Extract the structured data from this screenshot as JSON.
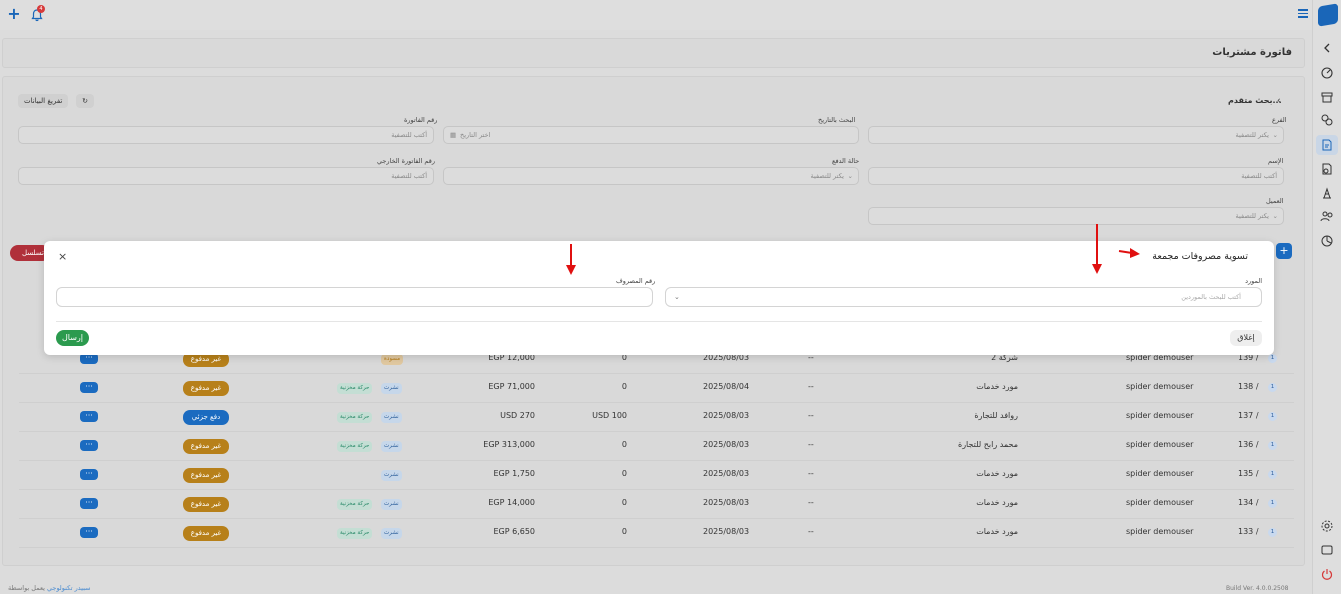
{
  "topbar": {
    "notification_count": "4"
  },
  "page": {
    "title": "فاتورة مشتريات"
  },
  "filters": {
    "refresh_label": "تفريغ البيانات",
    "advanced_search": "بحث متقدم...",
    "branch_label": "الفرع",
    "branch_placeholder": "يكتر للتصفية",
    "date_label": "البحث بالتاريخ",
    "date_placeholder": "اختر التاريخ",
    "invoice_no_label": "رقم الفاتورة",
    "invoice_no_placeholder": "أكتب للتصفية",
    "name_label": "الإسم",
    "name_placeholder": "أكتب للتصفية",
    "payment_status_label": "حالة الدفع",
    "payment_status_placeholder": "يكتر للتصفية",
    "ext_invoice_label": "رقم الفاتورة الخارجي",
    "ext_invoice_placeholder": "أكتب للتصفية",
    "client_label": "العميل",
    "client_placeholder": "يكتر للتصفية"
  },
  "toolbar": {
    "serial_label": "تسلسل",
    "add_label": "+"
  },
  "table": {
    "rows": [
      {
        "badge": "1",
        "id": "139 /",
        "user": "spider demouser",
        "supplier": "شركة 2",
        "ref": "--",
        "date": "2025/08/03",
        "paid": "0",
        "total": "EGP 12,000",
        "tags": [
          "مسودة"
        ],
        "status": "غير مدفوع",
        "status_kind": "unpaid"
      },
      {
        "badge": "1",
        "id": "138 /",
        "user": "spider demouser",
        "supplier": "مورد خدمات",
        "ref": "--",
        "date": "2025/08/04",
        "paid": "0",
        "total": "EGP 71,000",
        "tags": [
          "نشرت",
          "حركة مخزنية"
        ],
        "status": "غير مدفوع",
        "status_kind": "unpaid"
      },
      {
        "badge": "1",
        "id": "137 /",
        "user": "spider demouser",
        "supplier": "روافد للتجارة",
        "ref": "--",
        "date": "2025/08/03",
        "paid": "USD 100",
        "total": "USD 270",
        "tags": [
          "نشرت",
          "حركة مخزنية"
        ],
        "status": "دفع جزئي",
        "status_kind": "partial"
      },
      {
        "badge": "1",
        "id": "136 /",
        "user": "spider demouser",
        "supplier": "محمد رابح للتجارة",
        "ref": "--",
        "date": "2025/08/03",
        "paid": "0",
        "total": "EGP 313,000",
        "tags": [
          "نشرت",
          "حركة مخزنية"
        ],
        "status": "غير مدفوع",
        "status_kind": "unpaid"
      },
      {
        "badge": "1",
        "id": "135 /",
        "user": "spider demouser",
        "supplier": "مورد خدمات",
        "ref": "--",
        "date": "2025/08/03",
        "paid": "0",
        "total": "EGP 1,750",
        "tags": [
          "نشرت"
        ],
        "status": "غير مدفوع",
        "status_kind": "unpaid"
      },
      {
        "badge": "1",
        "id": "134 /",
        "user": "spider demouser",
        "supplier": "مورد خدمات",
        "ref": "--",
        "date": "2025/08/03",
        "paid": "0",
        "total": "EGP 14,000",
        "tags": [
          "نشرت",
          "حركة مخزنية"
        ],
        "status": "غير مدفوع",
        "status_kind": "unpaid"
      },
      {
        "badge": "1",
        "id": "133 /",
        "user": "spider demouser",
        "supplier": "مورد خدمات",
        "ref": "--",
        "date": "2025/08/03",
        "paid": "0",
        "total": "EGP 6,650",
        "tags": [
          "نشرت",
          "حركة مخزنية"
        ],
        "status": "غير مدفوع",
        "status_kind": "unpaid"
      }
    ],
    "actions_label": "···"
  },
  "modal": {
    "title": "تسوية مصروفات مجمعة",
    "supplier_label": "المورد",
    "supplier_placeholder": "أكتب للبحث بالموردين",
    "supplier_caret": "⌄",
    "expense_no_label": "رقم المصروف",
    "expense_no_value": "",
    "close_label": "إغلاق",
    "send_label": "إرسال",
    "close_icon": "×"
  },
  "footer": {
    "powered_prefix": "يعمل بواسطة",
    "powered_link": "سبيدر تكنولوجي",
    "build": "Build Ver. 4.0.0.2508"
  },
  "colors": {
    "primary": "#1b6bc0",
    "danger": "#b0303a",
    "unpaid": "#b7801a",
    "send": "#2b9a4e",
    "arrow": "#e01010"
  }
}
